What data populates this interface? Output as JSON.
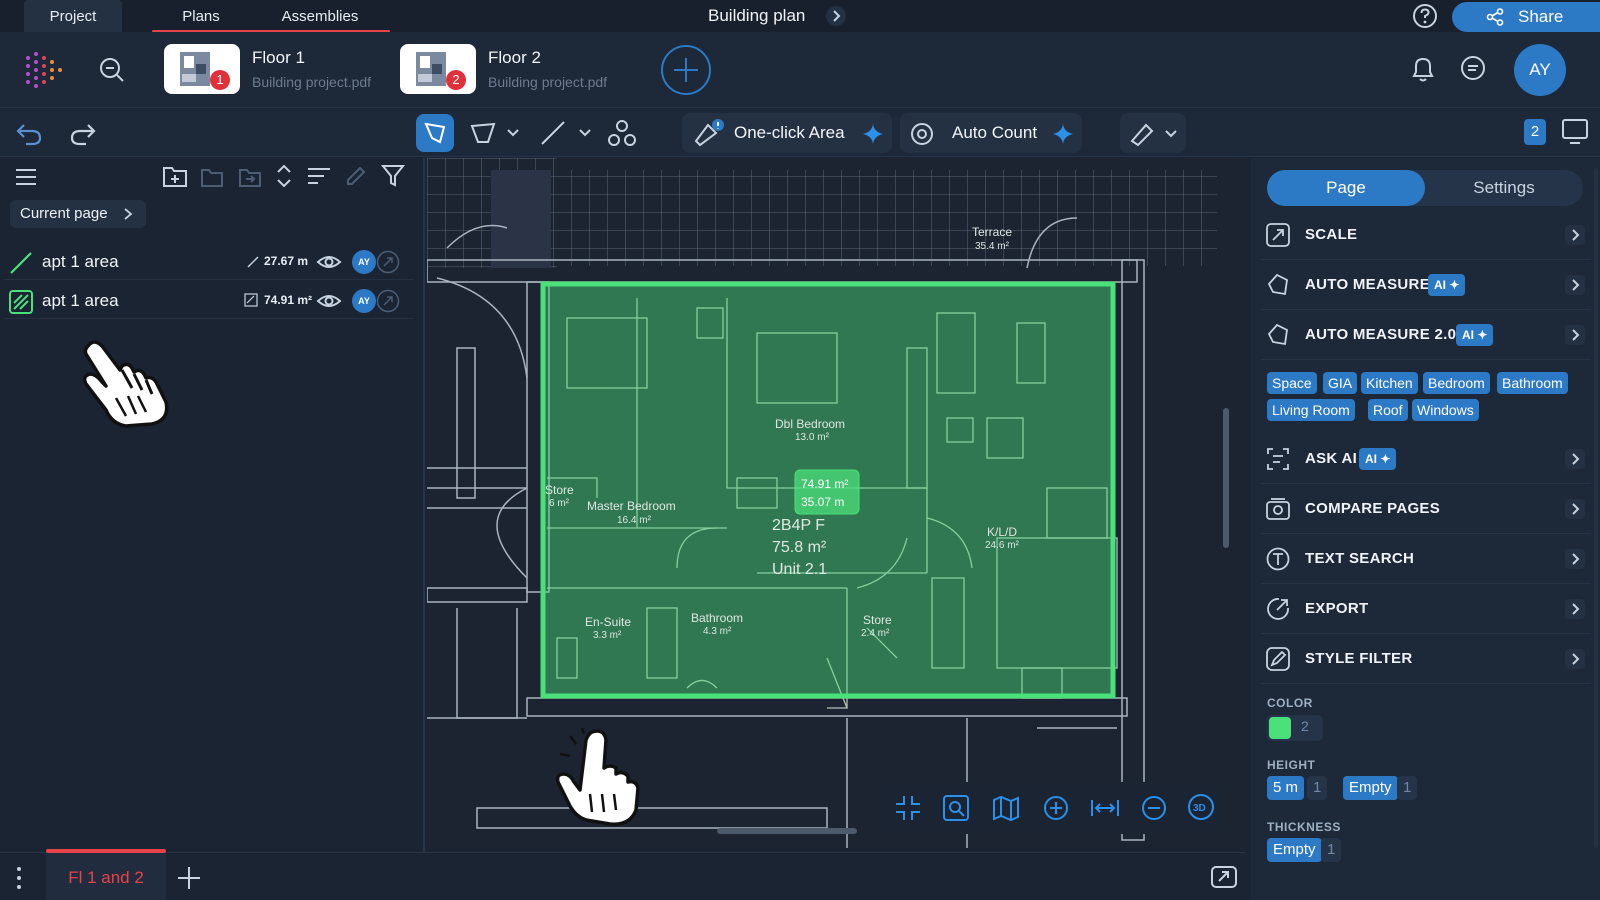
{
  "top_tabs": {
    "project": "Project",
    "plans": "Plans",
    "assemblies": "Assemblies"
  },
  "doc_title": "Building plan",
  "share_label": "Share",
  "floors": [
    {
      "name": "Floor 1",
      "file": "Building project.pdf",
      "badge": "1"
    },
    {
      "name": "Floor 2",
      "file": "Building project.pdf",
      "badge": "2"
    }
  ],
  "user_initials": "AY",
  "toolbar": {
    "one_click_area": "One-click Area",
    "auto_count": "Auto Count",
    "count_badge": "2"
  },
  "left_panel": {
    "current_page": "Current page",
    "layers": [
      {
        "name": "apt 1 area",
        "value": "27.67 m",
        "type": "line",
        "avatar": "AY"
      },
      {
        "name": "apt 1 area",
        "value": "74.91 m²",
        "type": "area",
        "avatar": "AY"
      }
    ]
  },
  "canvas": {
    "measure_area": "74.91 m²",
    "measure_length": "35.07 m",
    "unit_code": "2B4P F",
    "unit_area": "75.8 m²",
    "unit_name": "Unit 2.1",
    "rooms": [
      {
        "name": "Terrace",
        "area": "35.4 m²"
      },
      {
        "name": "Dbl Bedroom",
        "area": "13.0 m²"
      },
      {
        "name": "Master Bedroom",
        "area": "16.4 m²"
      },
      {
        "name": "Store",
        "area": "6 m²"
      },
      {
        "name": "K/L/D",
        "area": "24.6 m²"
      },
      {
        "name": "En-Suite",
        "area": "3.3 m²"
      },
      {
        "name": "Bathroom",
        "area": "4.3 m²"
      },
      {
        "name": "Store",
        "area": "2.4 m²"
      }
    ],
    "zoom_3d": "3D"
  },
  "right_panel": {
    "tabs": {
      "page": "Page",
      "settings": "Settings"
    },
    "menu": {
      "scale": "SCALE",
      "auto_measure": "AUTO MEASURE",
      "auto_measure_2": "AUTO MEASURE 2.0",
      "ask_ai": "ASK AI",
      "compare_pages": "COMPARE PAGES",
      "text_search": "TEXT SEARCH",
      "export": "EXPORT",
      "style_filter": "STYLE FILTER"
    },
    "ai_badge": "AI",
    "tags": [
      "Space",
      "GIA",
      "Kitchen",
      "Bedroom",
      "Bathroom",
      "Living Room",
      "Roof",
      "Windows"
    ],
    "color_label": "COLOR",
    "color_value": "#4ae07a",
    "color_count": "2",
    "height_label": "HEIGHT",
    "height_chips": [
      {
        "value": "5 m",
        "count": "1"
      },
      {
        "value": "Empty",
        "count": "1"
      }
    ],
    "thickness_label": "THICKNESS",
    "thickness_chips": [
      {
        "value": "Empty",
        "count": "1"
      }
    ]
  },
  "bottom": {
    "sheet_tab": "Fl 1 and 2"
  },
  "colors": {
    "accent": "#2c79c6",
    "danger": "#e8424a",
    "measure_green": "#4ae07a",
    "background": "#1a2433"
  }
}
